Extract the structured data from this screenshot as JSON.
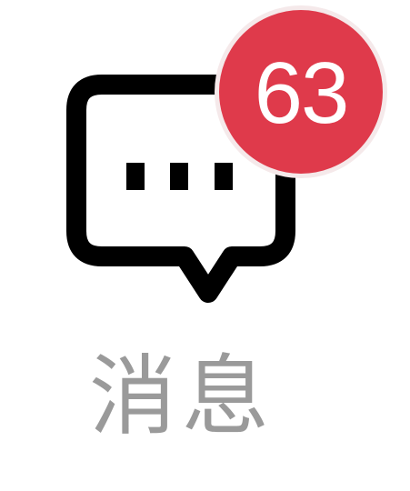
{
  "tab": {
    "icon": "message-bubble-icon",
    "badge_count": "63",
    "label": "消息"
  },
  "colors": {
    "badge_fill": "#df3a4b",
    "badge_border": "#f5e9ea",
    "icon_stroke": "#000000",
    "label_text": "#9a9a9a"
  }
}
